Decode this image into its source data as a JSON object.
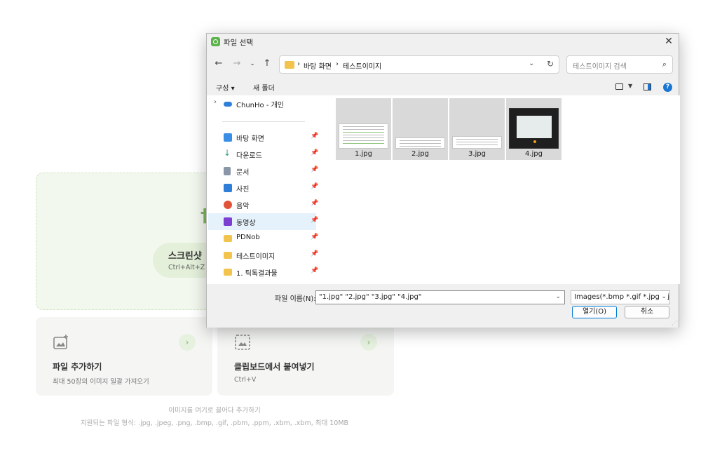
{
  "app": {
    "screenshot_title": "스크린샷",
    "screenshot_shortcut": "Ctrl+Alt+Z",
    "add_file_title": "파일 추가하기",
    "add_file_sub": "최대 50장의 이미지 일괄 가져오기",
    "paste_title": "클립보드에서 붙여넣기",
    "paste_sub": "Ctrl+V",
    "drag_hint": "이미지를 여기로 끌어다 추가하기",
    "formats_hint": "지원되는 파일 형식: .jpg, .jpeg, .png, .bmp, .gif, .pbm, .ppm, .xbm, .xbm, 최대 10MB",
    "accent_color": "#7ab85e"
  },
  "dialog": {
    "title": "파일 선택",
    "breadcrumb": [
      "바탕 화면",
      "테스트이미지"
    ],
    "search_placeholder": "테스트이미지 검색",
    "toolbar": {
      "organize": "구성",
      "new_folder": "새 폴더"
    },
    "sidebar": {
      "cloud": "ChunHo - 개인",
      "items": [
        {
          "label": "바탕 화면",
          "icon": "desktop-icon",
          "color": "#3a8ee6"
        },
        {
          "label": "다운로드",
          "icon": "download-icon",
          "color": "#2f9e6d"
        },
        {
          "label": "문서",
          "icon": "document-icon",
          "color": "#8b95a8"
        },
        {
          "label": "사진",
          "icon": "pictures-icon",
          "color": "#2f7fd8"
        },
        {
          "label": "음악",
          "icon": "music-icon",
          "color": "#e2543a"
        },
        {
          "label": "동영상",
          "icon": "videos-icon",
          "color": "#7b3fd1"
        },
        {
          "label": "PDNob",
          "icon": "folder-icon",
          "color": "#f2c44e"
        },
        {
          "label": "테스트이미지",
          "icon": "folder-icon",
          "color": "#f2c44e"
        },
        {
          "label": "1. 틱톡결과물",
          "icon": "folder-icon",
          "color": "#f2c44e"
        }
      ]
    },
    "files": [
      {
        "name": "1.jpg"
      },
      {
        "name": "2.jpg"
      },
      {
        "name": "3.jpg"
      },
      {
        "name": "4.jpg"
      }
    ],
    "filename_label": "파일 이름(N):",
    "filename_value": "\"1.jpg\" \"2.jpg\" \"3.jpg\" \"4.jpg\"",
    "filetype": "Images(*.bmp *.gif *.jpg *.jpeg",
    "open_label": "열기(O)",
    "cancel_label": "취소"
  }
}
